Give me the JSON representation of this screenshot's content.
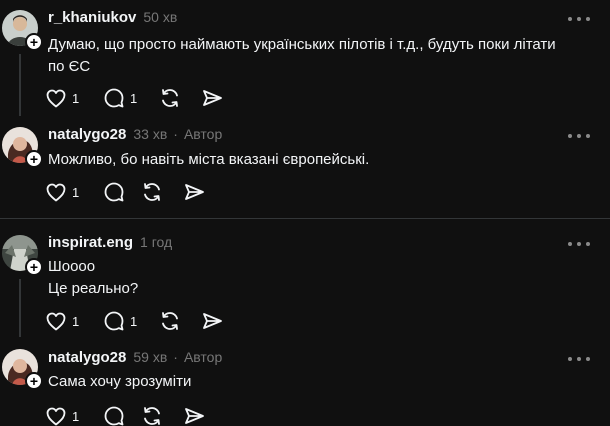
{
  "comments": [
    {
      "username": "r_khaniukov",
      "time": "50 хв",
      "author_tag": "",
      "lines": [
        "Думаю, що просто наймають українських пілотів і т.д., будуть поки літати",
        "по ЄС"
      ],
      "likes": "1",
      "replies": "1",
      "avatar_color": "#9aa39f"
    },
    {
      "username": "natalygo28",
      "time": "33 хв",
      "author_tag": "Автор",
      "lines": [
        "Можливо, бо навіть міста вказані європейські."
      ],
      "likes": "1",
      "replies": "",
      "avatar_color": "#7a4a3e"
    },
    {
      "username": "inspirat.eng",
      "time": "1 год",
      "author_tag": "",
      "lines": [
        "Шоооо",
        "Це реально?"
      ],
      "likes": "1",
      "replies": "1",
      "avatar_color": "#5c6158"
    },
    {
      "username": "natalygo28",
      "time": "59 хв",
      "author_tag": "Автор",
      "lines": [
        "Сама хочу зрозуміти"
      ],
      "likes": "1",
      "replies": "",
      "avatar_color": "#7a4a3e"
    }
  ],
  "separator": "·",
  "colors": {
    "background": "#101010",
    "text": "#f3f5f7",
    "muted": "#777777",
    "line": "#333638"
  }
}
